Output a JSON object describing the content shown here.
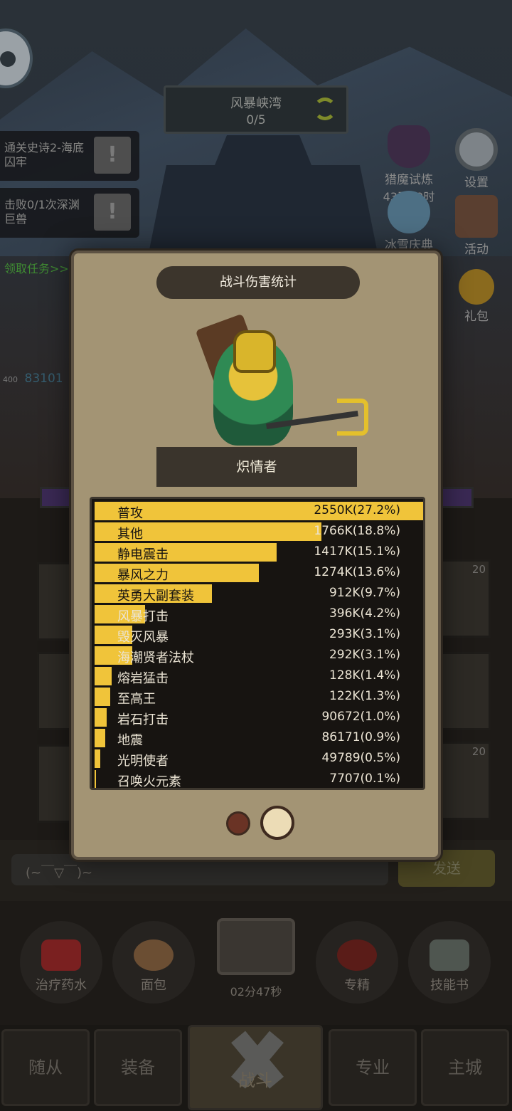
{
  "stage": {
    "name": "风暴峡湾",
    "progress": "0/5"
  },
  "quests": [
    {
      "text": "通关史诗2-海底囚牢"
    },
    {
      "text": "击败0/1次深渊巨兽"
    }
  ],
  "claim_quest": "领取任务>>",
  "side_buttons": {
    "demon_hunt": "猎魔试炼",
    "demon_hunt_timer": "43天19时",
    "settings": "设置",
    "ice_festival": "冰雪庆典",
    "events": "活动",
    "gift": "礼包"
  },
  "hero_tag": {
    "level": "400",
    "power": "83101"
  },
  "tile_levels": [
    "20",
    "20"
  ],
  "dialog": {
    "title": "战斗伤害统计",
    "hero_name": "炽情者",
    "stats": [
      {
        "name": "普攻",
        "value": "2550K(27.2%)",
        "percent": 27.2
      },
      {
        "name": "其他",
        "value": "1766K(18.8%)",
        "percent": 18.8
      },
      {
        "name": "静电震击",
        "value": "1417K(15.1%)",
        "percent": 15.1
      },
      {
        "name": "暴风之力",
        "value": "1274K(13.6%)",
        "percent": 13.6
      },
      {
        "name": "英勇大副套装",
        "value": "912K(9.7%)",
        "percent": 9.7
      },
      {
        "name": "风暴打击",
        "value": "396K(4.2%)",
        "percent": 4.2
      },
      {
        "name": "毁灭风暴",
        "value": "293K(3.1%)",
        "percent": 3.1
      },
      {
        "name": "海潮贤者法杖",
        "value": "292K(3.1%)",
        "percent": 3.1
      },
      {
        "name": "熔岩猛击",
        "value": "128K(1.4%)",
        "percent": 1.4
      },
      {
        "name": "至高王",
        "value": "122K(1.3%)",
        "percent": 1.3
      },
      {
        "name": "岩石打击",
        "value": "90672(1.0%)",
        "percent": 1.0
      },
      {
        "name": "地震",
        "value": "86171(0.9%)",
        "percent": 0.9
      },
      {
        "name": "光明使者",
        "value": "49789(0.5%)",
        "percent": 0.5
      },
      {
        "name": "召唤火元素",
        "value": "7707(0.1%)",
        "percent": 0.1
      }
    ],
    "page_current": 2,
    "page_total": 2
  },
  "chat": {
    "placeholder": "(~￣▽￣)~",
    "send": "发送"
  },
  "items": [
    {
      "label": "治疗药水"
    },
    {
      "label": "面包"
    },
    {
      "label": "专精"
    },
    {
      "label": "技能书"
    }
  ],
  "chest_timer": "02分47秒",
  "tabs": [
    {
      "label": "随从"
    },
    {
      "label": "装备"
    },
    {
      "label": "战斗"
    },
    {
      "label": "专业"
    },
    {
      "label": "主城"
    }
  ],
  "colors": {
    "bar": "#f0c43a",
    "panel": "#a39474"
  }
}
